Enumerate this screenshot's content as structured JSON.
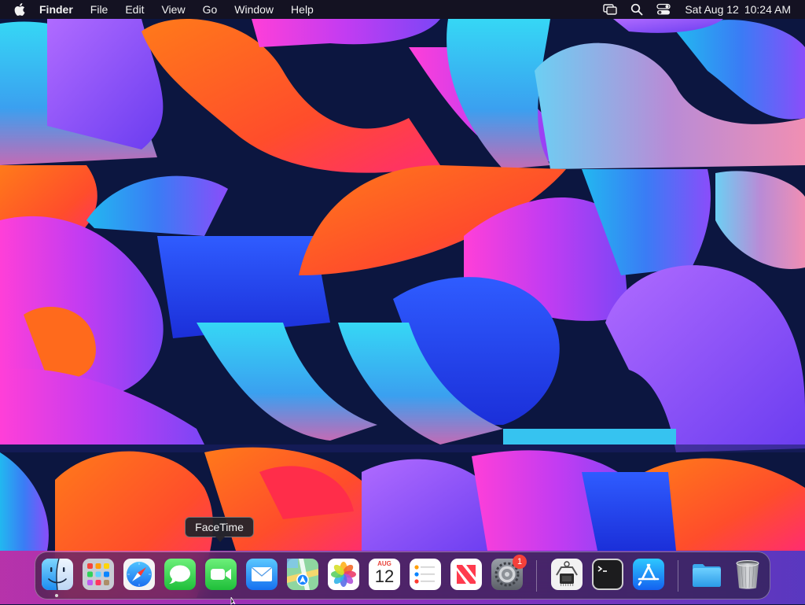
{
  "menubar": {
    "app_name": "Finder",
    "menus": [
      "File",
      "Edit",
      "View",
      "Go",
      "Window",
      "Help"
    ],
    "clock": {
      "date": "Sat Aug 12",
      "time": "10:24 AM"
    },
    "status_icons": [
      "screen-mirroring-icon",
      "spotlight-search-icon",
      "control-center-icon"
    ]
  },
  "tooltip": {
    "text": "FaceTime"
  },
  "dock": {
    "apps": [
      {
        "name": "Finder",
        "icon": "finder-icon",
        "running": true
      },
      {
        "name": "Launchpad",
        "icon": "launchpad-icon",
        "running": false
      },
      {
        "name": "Safari",
        "icon": "safari-icon",
        "running": false
      },
      {
        "name": "Messages",
        "icon": "messages-icon",
        "running": false
      },
      {
        "name": "FaceTime",
        "icon": "facetime-icon",
        "running": false
      },
      {
        "name": "Mail",
        "icon": "mail-icon",
        "running": false
      },
      {
        "name": "Maps",
        "icon": "maps-icon",
        "running": false
      },
      {
        "name": "Photos",
        "icon": "photos-icon",
        "running": false
      },
      {
        "name": "Calendar",
        "icon": "calendar-icon",
        "running": false,
        "month": "AUG",
        "day": "12"
      },
      {
        "name": "Reminders",
        "icon": "reminders-icon",
        "running": false
      },
      {
        "name": "News",
        "icon": "news-icon",
        "running": false
      },
      {
        "name": "System Settings",
        "icon": "system-settings-icon",
        "running": false,
        "badge": "1"
      },
      {
        "name": "System Information",
        "icon": "system-information-icon",
        "running": false
      },
      {
        "name": "Terminal",
        "icon": "terminal-icon",
        "running": false
      },
      {
        "name": "App Store",
        "icon": "app-store-icon",
        "running": false
      },
      {
        "name": "Downloads",
        "icon": "folder-icon",
        "running": false
      },
      {
        "name": "Trash",
        "icon": "trash-icon",
        "running": false
      }
    ]
  },
  "colors": {
    "menubar_bg": "#16121e",
    "wallpaper_base": "#0c1640",
    "badge_red": "#f4403a"
  }
}
